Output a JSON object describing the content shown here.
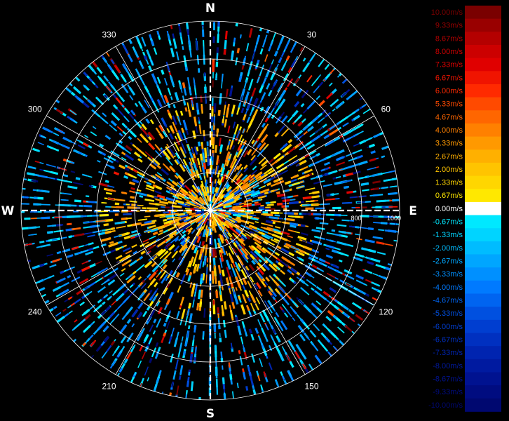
{
  "chart_data": {
    "type": "polar-radial-velocity",
    "title": "",
    "directions": {
      "north": "N",
      "east": "E",
      "south": "S",
      "west": "W"
    },
    "angle_labels": [
      {
        "deg": 30,
        "text": "30"
      },
      {
        "deg": 60,
        "text": "60"
      },
      {
        "deg": 120,
        "text": "120"
      },
      {
        "deg": 150,
        "text": "150"
      },
      {
        "deg": 210,
        "text": "210"
      },
      {
        "deg": 240,
        "text": "240"
      },
      {
        "deg": 300,
        "text": "300"
      },
      {
        "deg": 330,
        "text": "330"
      }
    ],
    "range_rings": [
      200,
      400,
      600,
      800,
      1000
    ],
    "range_labels": [
      {
        "value": 800,
        "text": "800"
      },
      {
        "value": 1000,
        "text": "1000"
      }
    ],
    "range_max": 1000,
    "colorbar": {
      "labels": [
        "10.00m/s",
        "9.33m/s",
        "8.67m/s",
        "8.00m/s",
        "7.33m/s",
        "6.67m/s",
        "6.00m/s",
        "5.33m/s",
        "4.67m/s",
        "4.00m/s",
        "3.33m/s",
        "2.67m/s",
        "2.00m/s",
        "1.33m/s",
        "0.67m/s",
        "0.00m/s",
        "-0.67m/s",
        "-1.33m/s",
        "-2.00m/s",
        "-2.67m/s",
        "-3.33m/s",
        "-4.00m/s",
        "-4.67m/s",
        "-5.33m/s",
        "-6.00m/s",
        "-6.67m/s",
        "-7.33m/s",
        "-8.00m/s",
        "-8.67m/s",
        "-9.33m/s",
        "-10.00m/s"
      ],
      "colors": [
        "#7a0000",
        "#990000",
        "#b40000",
        "#cc0000",
        "#e00000",
        "#f01400",
        "#ff2a00",
        "#ff4a00",
        "#ff6600",
        "#ff8000",
        "#ff9900",
        "#ffb000",
        "#ffc400",
        "#ffd600",
        "#ffe800",
        "#ffffff",
        "#00e8ff",
        "#00d4ff",
        "#00bcff",
        "#00a6ff",
        "#0090ff",
        "#007aff",
        "#0064f0",
        "#0050e0",
        "#003ed0",
        "#0030c0",
        "#0024b0",
        "#001aa0",
        "#001290",
        "#000c80",
        "#000870"
      ]
    }
  }
}
